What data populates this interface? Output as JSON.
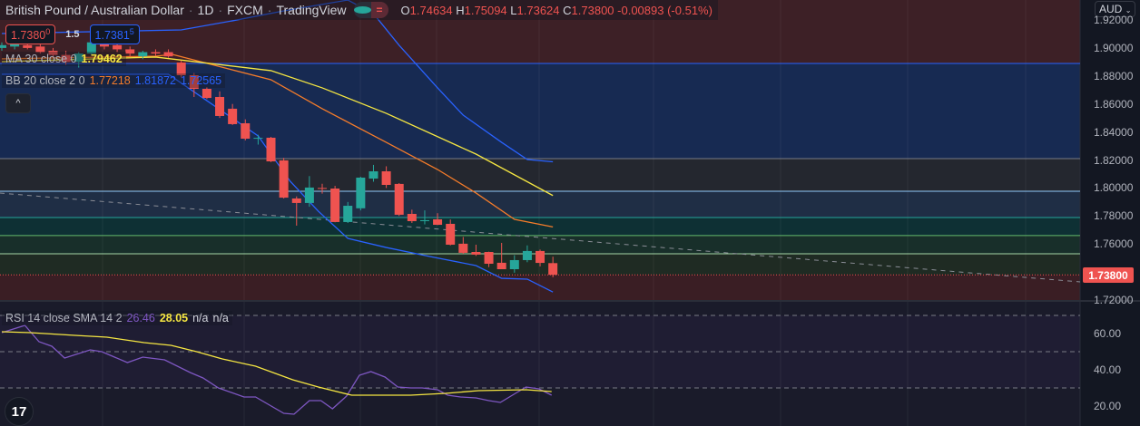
{
  "header": {
    "symbol": "British Pound / Australian Dollar",
    "interval": "1D",
    "exchange": "FXCM",
    "source": "TradingView",
    "ohlc": {
      "o_label": "O",
      "o": "1.74634",
      "h_label": "H",
      "h": "1.75094",
      "l_label": "L",
      "l": "1.73624",
      "c_label": "C",
      "c": "1.73800",
      "change": "-0.00893 (-0.51%)"
    }
  },
  "trade": {
    "sell_price": "1.7380",
    "sell_sup": "0",
    "spread": "1.5",
    "buy_price": "1.7381",
    "buy_sup": "5"
  },
  "indicators": {
    "ma": {
      "label": "MA 30 close 0",
      "value": "1.79462"
    },
    "bb": {
      "label": "BB 20 close 2 0",
      "basis": "1.77218",
      "upper": "1.81872",
      "lower": "1.72565"
    },
    "rsi": {
      "label": "RSI 14 close SMA 14 2",
      "rsi": "26.46",
      "sma": "28.05",
      "na1": "n/a",
      "na2": "n/a"
    }
  },
  "axis": {
    "currency": "AUD",
    "price_ticks": [
      "1.92000",
      "1.90000",
      "1.88000",
      "1.86000",
      "1.84000",
      "1.82000",
      "1.80000",
      "1.78000",
      "1.76000",
      "1.72000"
    ],
    "current_price": "1.73800",
    "rsi_ticks": [
      "60.00",
      "40.00",
      "20.00"
    ]
  },
  "colors": {
    "bg": "#131722",
    "up": "#26a69a",
    "down": "#ef5350",
    "ma": "#f5e642",
    "bb_basis": "#f57c2a",
    "bb_band": "#2962ff",
    "rsi": "#7e57c2"
  },
  "chart_data": {
    "type": "candlestick",
    "price_range": [
      1.72,
      1.92
    ],
    "candles": [
      [
        1.9,
        1.904,
        1.898,
        1.902
      ],
      [
        1.901,
        1.905,
        1.899,
        1.903
      ],
      [
        1.902,
        1.904,
        1.899,
        1.9
      ],
      [
        1.901,
        1.903,
        1.896,
        1.897
      ],
      [
        1.898,
        1.9,
        1.893,
        1.895
      ],
      [
        1.895,
        1.898,
        1.888,
        1.89
      ],
      [
        1.89,
        1.897,
        1.886,
        1.896
      ],
      [
        1.896,
        1.906,
        1.895,
        1.904
      ],
      [
        1.903,
        1.905,
        1.899,
        1.901
      ],
      [
        1.902,
        1.905,
        1.897,
        1.899
      ],
      [
        1.899,
        1.901,
        1.894,
        1.896
      ],
      [
        1.894,
        1.898,
        1.892,
        1.897
      ],
      [
        1.897,
        1.899,
        1.894,
        1.896
      ],
      [
        1.897,
        1.899,
        1.893,
        1.894
      ],
      [
        1.8896,
        1.891,
        1.879,
        1.8805
      ],
      [
        1.8805,
        1.882,
        1.865,
        1.8708
      ],
      [
        1.8708,
        1.872,
        1.8635,
        1.8643
      ],
      [
        1.865,
        1.869,
        1.85,
        1.8514
      ],
      [
        1.8566,
        1.86,
        1.845,
        1.8456
      ],
      [
        1.8462,
        1.849,
        1.834,
        1.8352
      ],
      [
        1.8352,
        1.838,
        1.831,
        1.8358
      ],
      [
        1.8359,
        1.8365,
        1.8185,
        1.819
      ],
      [
        1.8197,
        1.8215,
        1.7925,
        1.7931
      ],
      [
        1.7925,
        1.794,
        1.7731,
        1.7893
      ],
      [
        1.7893,
        1.8085,
        1.7866,
        1.8003
      ],
      [
        1.8,
        1.803,
        1.796,
        1.7995
      ],
      [
        1.7996,
        1.8015,
        1.7755,
        1.7757
      ],
      [
        1.7757,
        1.79,
        1.775,
        1.7873
      ],
      [
        1.7855,
        1.808,
        1.784,
        1.8074
      ],
      [
        1.8067,
        1.8165,
        1.8045,
        1.8119
      ],
      [
        1.8119,
        1.8155,
        1.8,
        1.8022
      ],
      [
        1.8029,
        1.8035,
        1.78,
        1.7809
      ],
      [
        1.7815,
        1.7845,
        1.775,
        1.7763
      ],
      [
        1.7763,
        1.784,
        1.774,
        1.777
      ],
      [
        1.7776,
        1.782,
        1.7735,
        1.7737
      ],
      [
        1.7744,
        1.7775,
        1.759,
        1.7595
      ],
      [
        1.7602,
        1.765,
        1.753,
        1.7537
      ],
      [
        1.7543,
        1.7595,
        1.7515,
        1.7524
      ],
      [
        1.7543,
        1.7545,
        1.7435,
        1.7459
      ],
      [
        1.7466,
        1.7608,
        1.742,
        1.742
      ],
      [
        1.742,
        1.752,
        1.7395,
        1.7485
      ],
      [
        1.7485,
        1.759,
        1.747,
        1.755
      ],
      [
        1.755,
        1.756,
        1.744,
        1.7465
      ],
      [
        1.74634,
        1.75094,
        1.73624,
        1.738
      ]
    ],
    "bb_upper": [
      [
        0,
        1.9103
      ],
      [
        14,
        1.9129
      ],
      [
        18,
        1.9194
      ],
      [
        22,
        1.9265
      ],
      [
        27,
        1.9342
      ],
      [
        29,
        1.9245
      ],
      [
        31,
        1.9019
      ],
      [
        34,
        1.8715
      ],
      [
        36,
        1.852
      ],
      [
        39,
        1.8326
      ],
      [
        41,
        1.8203
      ],
      [
        43,
        1.8187
      ]
    ],
    "bb_basis": [
      [
        0,
        1.8922
      ],
      [
        12,
        1.8941
      ],
      [
        13.3,
        1.8954
      ],
      [
        21,
        1.8773
      ],
      [
        25,
        1.8566
      ],
      [
        30,
        1.8326
      ],
      [
        34,
        1.8132
      ],
      [
        37,
        1.7964
      ],
      [
        40,
        1.7776
      ],
      [
        43,
        1.7722
      ]
    ],
    "bb_lower": [
      [
        0,
        1.8812
      ],
      [
        13,
        1.8812
      ],
      [
        20,
        1.8372
      ],
      [
        22.5,
        1.8048
      ],
      [
        24.7,
        1.7834
      ],
      [
        27,
        1.764
      ],
      [
        30,
        1.7575
      ],
      [
        33.4,
        1.7511
      ],
      [
        37,
        1.7446
      ],
      [
        39,
        1.7355
      ],
      [
        41,
        1.7349
      ],
      [
        43,
        1.7257
      ]
    ],
    "ma30": [
      [
        0,
        1.8902
      ],
      [
        12,
        1.8935
      ],
      [
        21,
        1.8838
      ],
      [
        25,
        1.8715
      ],
      [
        30,
        1.8533
      ],
      [
        37,
        1.8242
      ],
      [
        43,
        1.7946
      ]
    ],
    "levels": [
      1.8889,
      1.821,
      1.7977,
      1.7789,
      1.766,
      1.753
    ],
    "rsi_range": [
      10,
      78
    ],
    "rsi": [
      [
        0,
        60.5
      ],
      [
        1.8,
        64.5
      ],
      [
        2.9,
        55.5
      ],
      [
        3.9,
        53
      ],
      [
        4.9,
        46.5
      ],
      [
        6.9,
        51
      ],
      [
        7.8,
        50
      ],
      [
        9.8,
        44
      ],
      [
        11,
        47
      ],
      [
        12.7,
        45.5
      ],
      [
        14.7,
        38.5
      ],
      [
        15.7,
        35.5
      ],
      [
        16.9,
        30
      ],
      [
        18.9,
        25
      ],
      [
        19.8,
        25
      ],
      [
        22,
        16
      ],
      [
        22.8,
        15.5
      ],
      [
        24,
        23
      ],
      [
        24.9,
        23
      ],
      [
        25.8,
        18.5
      ],
      [
        26.9,
        25.5
      ],
      [
        27.9,
        37
      ],
      [
        28.8,
        39
      ],
      [
        29.9,
        36
      ],
      [
        30.9,
        30.5
      ],
      [
        31.9,
        30
      ],
      [
        32.8,
        30
      ],
      [
        34,
        29
      ],
      [
        34.8,
        26
      ],
      [
        35.8,
        25
      ],
      [
        37,
        24.5
      ],
      [
        38,
        23
      ],
      [
        38.9,
        22
      ],
      [
        40.9,
        30.5
      ],
      [
        41.9,
        29.5
      ],
      [
        42.9,
        26
      ]
    ],
    "rsi_sma": [
      [
        0,
        61
      ],
      [
        2.2,
        60.5
      ],
      [
        5.7,
        59
      ],
      [
        8.2,
        58
      ],
      [
        11.1,
        55
      ],
      [
        13.2,
        53.5
      ],
      [
        15.2,
        50
      ],
      [
        17.2,
        46
      ],
      [
        19.8,
        42
      ],
      [
        22.7,
        34.5
      ],
      [
        24.7,
        30.5
      ],
      [
        27.3,
        26
      ],
      [
        31.9,
        26
      ],
      [
        34.6,
        27
      ],
      [
        37.2,
        28.5
      ],
      [
        40.9,
        29
      ],
      [
        42.9,
        28
      ]
    ],
    "rsi_levels": [
      70,
      50,
      30
    ]
  }
}
